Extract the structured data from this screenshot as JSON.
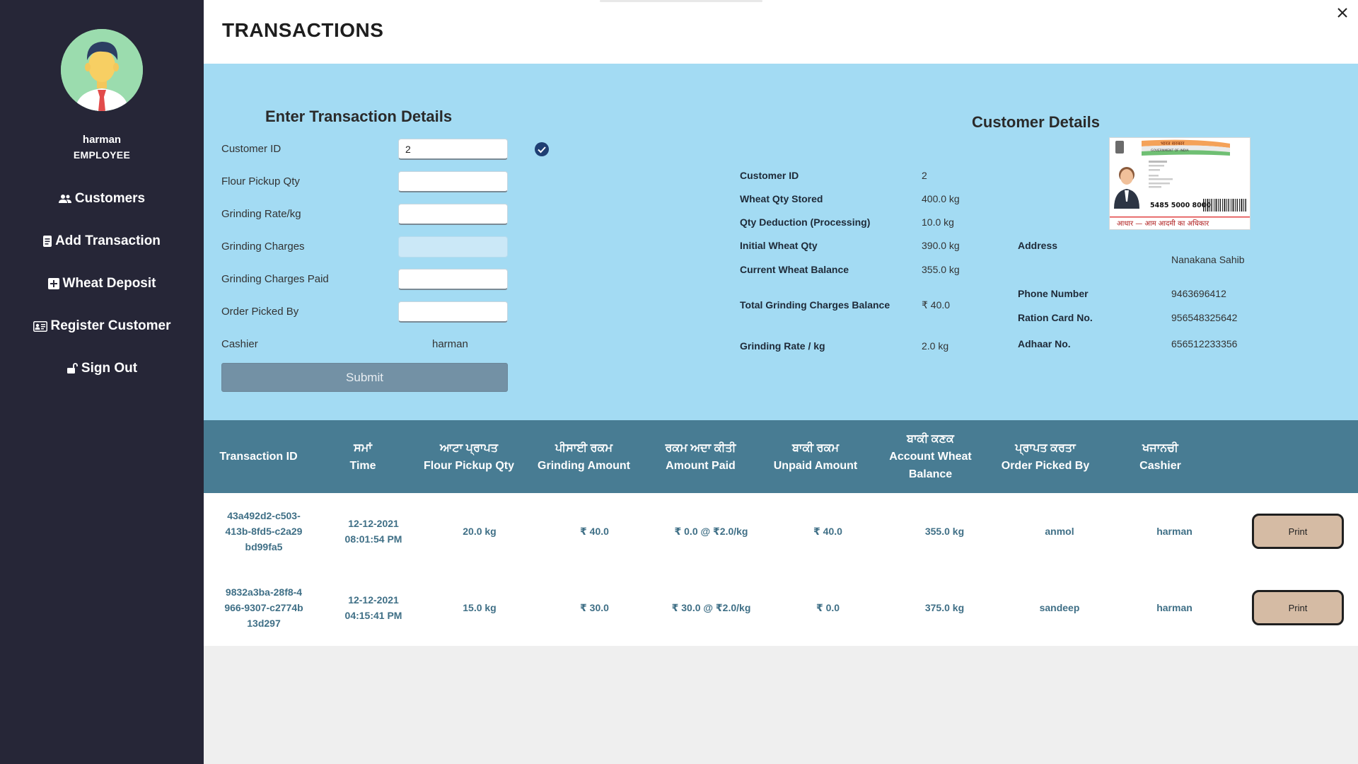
{
  "sidebar": {
    "user_name": "harman",
    "user_role": "EMPLOYEE",
    "items": [
      {
        "label": "Customers",
        "icon": "users-icon"
      },
      {
        "label": "Add Transaction",
        "icon": "receipt-icon"
      },
      {
        "label": "Wheat Deposit",
        "icon": "plus-square-icon"
      },
      {
        "label": "Register Customer",
        "icon": "id-card-icon"
      },
      {
        "label": "Sign Out",
        "icon": "unlock-icon"
      }
    ]
  },
  "page": {
    "title": "TRANSACTIONS"
  },
  "form": {
    "title": "Enter Transaction Details",
    "fields": {
      "customer_id": {
        "label": "Customer ID",
        "value": "2"
      },
      "flour_pickup_qty": {
        "label": "Flour Pickup Qty",
        "value": ""
      },
      "grinding_rate": {
        "label": "Grinding Rate/kg",
        "value": ""
      },
      "grinding_charges": {
        "label": "Grinding Charges",
        "value": ""
      },
      "grinding_charges_paid": {
        "label": "Grinding Charges Paid",
        "value": ""
      },
      "order_picked_by": {
        "label": "Order Picked By",
        "value": ""
      }
    },
    "cashier_label": "Cashier",
    "cashier_value": "harman",
    "submit_label": "Submit"
  },
  "customer_details": {
    "title": "Customer Details",
    "customer_id": {
      "label": "Customer ID",
      "value": "2"
    },
    "wheat_qty_stored": {
      "label": "Wheat Qty Stored",
      "value": "400.0 kg"
    },
    "qty_deduction": {
      "label": "Qty Deduction (Processing)",
      "value": "10.0 kg"
    },
    "initial_wheat_qty": {
      "label": "Initial Wheat Qty",
      "value": "390.0 kg"
    },
    "current_wheat_balance": {
      "label": "Current Wheat Balance",
      "value": "355.0 kg"
    },
    "total_grinding_charges_balance": {
      "label": "Total Grinding Charges Balance",
      "value": "₹ 40.0"
    },
    "grinding_rate": {
      "label": "Grinding Rate  / kg",
      "value": "2.0 kg"
    },
    "address": {
      "label": "Address",
      "value": "Nanakana Sahib"
    },
    "phone": {
      "label": "Phone Number",
      "value": "9463696412"
    },
    "ration_card": {
      "label": "Ration Card No.",
      "value": "956548325642"
    },
    "adhaar": {
      "label": "Adhaar No.",
      "value": "656512233356"
    },
    "id_card": {
      "header_hi": "भारत सरकार",
      "header_en": "GOVERNMENT OF INDIA",
      "number": "5485 5000 8000",
      "footer": "आधार — आम आदमी का अधिकार"
    }
  },
  "table": {
    "headers": [
      {
        "pa": "",
        "en": "Transaction ID"
      },
      {
        "pa": "ਸਮਾਂ",
        "en": "Time"
      },
      {
        "pa": "ਆਟਾ ਪ੍ਰਾਪਤ",
        "en": "Flour Pickup Qty"
      },
      {
        "pa": "ਪੀਸਾਈ ਰਕਮ",
        "en": "Grinding Amount"
      },
      {
        "pa": "ਰਕਮ ਅਦਾ ਕੀਤੀ",
        "en": "Amount Paid"
      },
      {
        "pa": "ਬਾਕੀ ਰਕਮ",
        "en": "Unpaid Amount"
      },
      {
        "pa": "ਬਾਕੀ ਕਣਕ",
        "en": "Account Wheat",
        "en2": "Balance"
      },
      {
        "pa": "ਪ੍ਰਾਪਤ ਕਰਤਾ",
        "en": "Order Picked By"
      },
      {
        "pa": "ਖਜਾਨਚੀ",
        "en": "Cashier"
      }
    ],
    "rows": [
      {
        "id_lines": [
          "43a492d2-c503-",
          "413b-8fd5-c2a29",
          "bd99fa5"
        ],
        "time_lines": [
          "12-12-2021",
          "08:01:54 PM"
        ],
        "flour": "20.0 kg",
        "grinding": "₹ 40.0",
        "paid": "₹ 0.0 @ ₹2.0/kg",
        "unpaid": "₹ 40.0",
        "wheat_balance": "355.0 kg",
        "picked_by": "anmol",
        "cashier": "harman",
        "print_label": "Print"
      },
      {
        "id_lines": [
          "9832a3ba-28f8-4",
          "966-9307-c2774b",
          "13d297"
        ],
        "time_lines": [
          "12-12-2021",
          "04:15:41 PM"
        ],
        "flour": "15.0 kg",
        "grinding": "₹ 30.0",
        "paid": "₹ 30.0 @ ₹2.0/kg",
        "unpaid": "₹ 0.0",
        "wheat_balance": "375.0 kg",
        "picked_by": "sandeep",
        "cashier": "harman",
        "print_label": "Print"
      }
    ]
  },
  "colors": {
    "sidebar_bg": "#262637",
    "panel_bg": "#a3dbf3",
    "table_header_bg": "#487c93",
    "cell_text": "#3f6f86",
    "print_button": "#d5bba4",
    "submit_button": "#7391a5"
  }
}
